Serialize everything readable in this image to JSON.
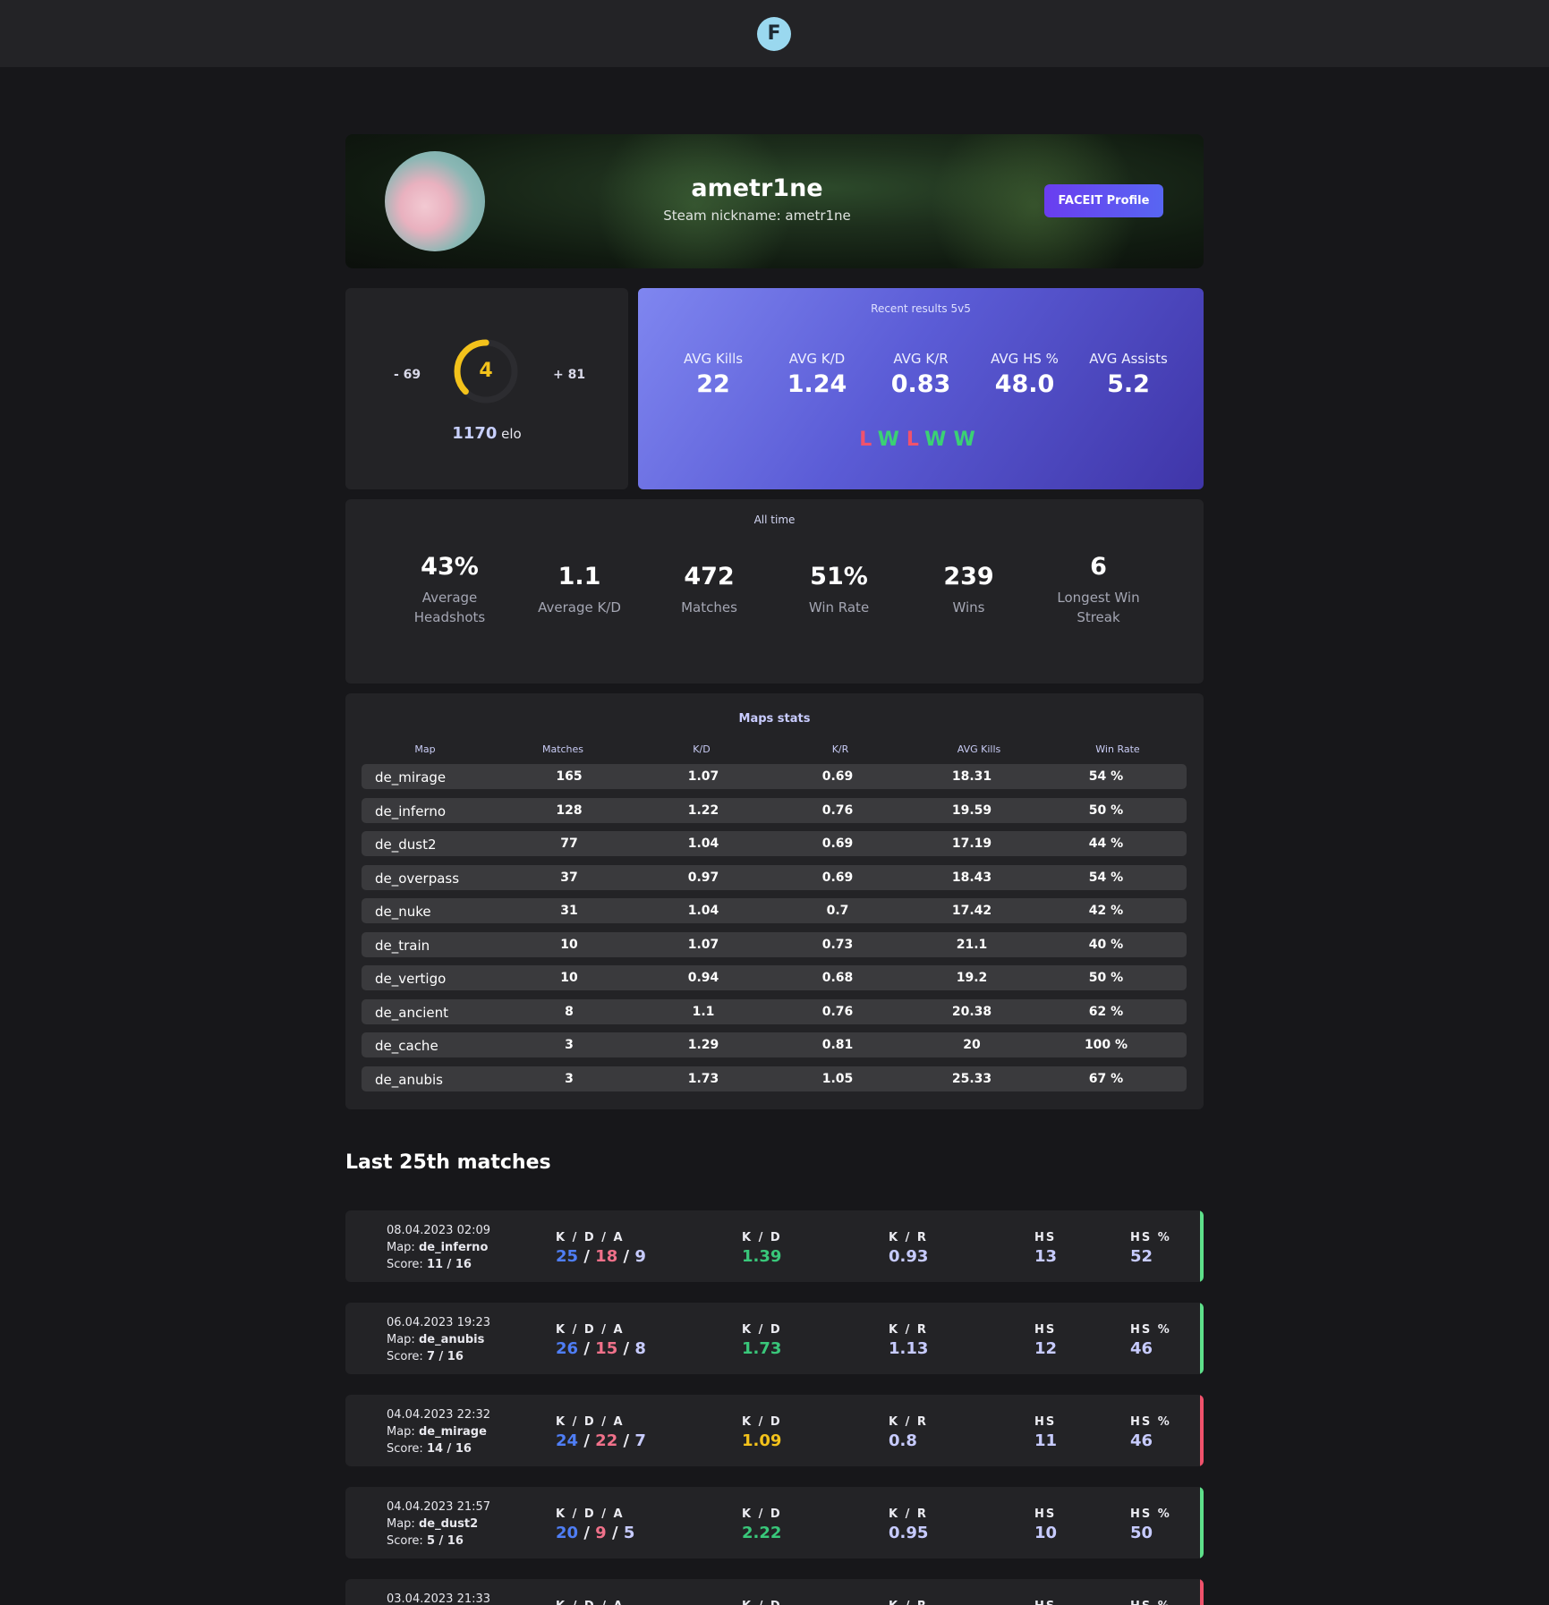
{
  "header": {
    "logo_letter": "F"
  },
  "profile": {
    "nickname": "ametr1ne",
    "steam_nickname": "Steam nickname: ametr1ne",
    "faceit_button": "FACEIT Profile"
  },
  "elo": {
    "minus": "- 69",
    "plus": "+ 81",
    "level": "4",
    "level_progress": 0.5,
    "value": "1170",
    "unit": "elo"
  },
  "recent": {
    "title": "Recent results 5v5",
    "stats": [
      {
        "label": "AVG Kills",
        "value": "22"
      },
      {
        "label": "AVG K/D",
        "value": "1.24"
      },
      {
        "label": "AVG K/R",
        "value": "0.83"
      },
      {
        "label": "AVG HS %",
        "value": "48.0"
      },
      {
        "label": "AVG Assists",
        "value": "5.2"
      }
    ],
    "results": [
      "L",
      "W",
      "L",
      "W",
      "W"
    ]
  },
  "alltime": {
    "title": "All time",
    "stats": [
      {
        "value": "43%",
        "label": "Average Headshots"
      },
      {
        "value": "1.1",
        "label": "Average K/D"
      },
      {
        "value": "472",
        "label": "Matches"
      },
      {
        "value": "51%",
        "label": "Win Rate"
      },
      {
        "value": "239",
        "label": "Wins"
      },
      {
        "value": "6",
        "label": "Longest Win Streak"
      }
    ]
  },
  "maps": {
    "title": "Maps stats",
    "headers": [
      "Map",
      "Matches",
      "K/D",
      "K/R",
      "AVG Kills",
      "Win Rate"
    ],
    "rows": [
      [
        "de_mirage",
        "165",
        "1.07",
        "0.69",
        "18.31",
        "54 %"
      ],
      [
        "de_inferno",
        "128",
        "1.22",
        "0.76",
        "19.59",
        "50 %"
      ],
      [
        "de_dust2",
        "77",
        "1.04",
        "0.69",
        "17.19",
        "44 %"
      ],
      [
        "de_overpass",
        "37",
        "0.97",
        "0.69",
        "18.43",
        "54 %"
      ],
      [
        "de_nuke",
        "31",
        "1.04",
        "0.7",
        "17.42",
        "42 %"
      ],
      [
        "de_train",
        "10",
        "1.07",
        "0.73",
        "21.1",
        "40 %"
      ],
      [
        "de_vertigo",
        "10",
        "0.94",
        "0.68",
        "19.2",
        "50 %"
      ],
      [
        "de_ancient",
        "8",
        "1.1",
        "0.76",
        "20.38",
        "62 %"
      ],
      [
        "de_cache",
        "3",
        "1.29",
        "0.81",
        "20",
        "100 %"
      ],
      [
        "de_anubis",
        "3",
        "1.73",
        "1.05",
        "25.33",
        "67 %"
      ]
    ]
  },
  "matches": {
    "title": "Last 25th matches",
    "col_kda": "K / D / A",
    "col_kd": "K / D",
    "col_kr": "K / R",
    "col_hs": "HS",
    "col_hsp": "HS %",
    "map_prefix": "Map:",
    "score_prefix": "Score:",
    "items": [
      {
        "date": "08.04.2023 02:09",
        "map": "de_inferno",
        "score": "11 / 16",
        "k": "25",
        "d": "18",
        "a": "9",
        "kd": "1.39",
        "kr": "0.93",
        "hs": "13",
        "hsp": "52",
        "result": "win",
        "kd_color": "#39c77a",
        "bar_color": "#5ee08a"
      },
      {
        "date": "06.04.2023 19:23",
        "map": "de_anubis",
        "score": "7 / 16",
        "k": "26",
        "d": "15",
        "a": "8",
        "kd": "1.73",
        "kr": "1.13",
        "hs": "12",
        "hsp": "46",
        "result": "win",
        "kd_color": "#39c77a",
        "bar_color": "#5ee08a"
      },
      {
        "date": "04.04.2023 22:32",
        "map": "de_mirage",
        "score": "14 / 16",
        "k": "24",
        "d": "22",
        "a": "7",
        "kd": "1.09",
        "kr": "0.8",
        "hs": "11",
        "hsp": "46",
        "result": "loss",
        "kd_color": "#f3c21b",
        "bar_color": "#f0526c"
      },
      {
        "date": "04.04.2023 21:57",
        "map": "de_dust2",
        "score": "5 / 16",
        "k": "20",
        "d": "9",
        "a": "5",
        "kd": "2.22",
        "kr": "0.95",
        "hs": "10",
        "hsp": "50",
        "result": "win",
        "kd_color": "#39c77a",
        "bar_color": "#5ee08a"
      },
      {
        "date": "03.04.2023 21:33",
        "map": "",
        "score": "",
        "k": "",
        "d": "",
        "a": "",
        "kd": "",
        "kr": "",
        "hs": "",
        "hsp": "",
        "result": "loss",
        "kd_color": "#f3c21b",
        "bar_color": "#f0526c"
      }
    ]
  }
}
